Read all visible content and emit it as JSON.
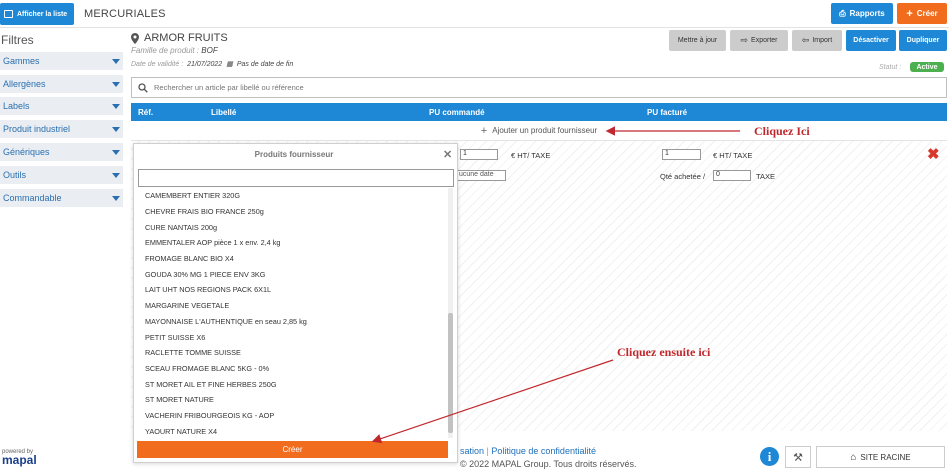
{
  "topbar": {
    "list_button": "Afficher la liste",
    "title": "MERCURIALES",
    "reports_button": "Rapports",
    "create_button": "Créer"
  },
  "sidebar": {
    "title": "Filtres",
    "items": [
      {
        "label": "Gammes"
      },
      {
        "label": "Allergènes"
      },
      {
        "label": "Labels"
      },
      {
        "label": "Produit industriel"
      },
      {
        "label": "Génériques"
      },
      {
        "label": "Outils"
      },
      {
        "label": "Commandable"
      }
    ]
  },
  "header": {
    "product_name": "ARMOR FRUITS",
    "family_label": "Famille de produit :",
    "family_value": "BOF",
    "validity_label": "Date de validité :",
    "validity_date": "21/07/2022",
    "validity_end": "Pas de date de fin",
    "status_label": "Statut :",
    "status_value": "Active"
  },
  "toolbar": {
    "update": "Mettre à jour",
    "export": "Exporter",
    "import": "Import",
    "deactivate": "Désactiver",
    "duplicate": "Dupliquer"
  },
  "search": {
    "placeholder": "Rechercher un article par libellé ou référence"
  },
  "table": {
    "headers": [
      "Réf.",
      "Libellé",
      "PU commandé",
      "PU facturé"
    ],
    "add_label": "Ajouter un produit fournisseur",
    "row": {
      "pu_cmd_value": "1",
      "pu_cmd_unit": "€ HT/ TAXE",
      "pu_fact_value": "1",
      "pu_fact_unit": "€ HT/ TAXE",
      "date_placeholder": "ucune date",
      "qty_label": "Qté achetée /",
      "qty_value": "0",
      "qty_unit": "TAXE"
    }
  },
  "dropdown": {
    "title": "Produits fournisseur",
    "items": [
      "CAMEMBERT ENTIER 320G",
      "CHEVRE FRAIS BIO FRANCE 250g",
      "CURE NANTAIS 200g",
      "EMMENTALER AOP pièce 1 x env. 2,4 kg",
      "FROMAGE BLANC BIO X4",
      "GOUDA 30% MG 1 PIECE ENV 3KG",
      "LAIT UHT NOS REGIONS PACK 6X1L",
      "MARGARINE VEGETALE",
      "MAYONNAISE L'AUTHENTIQUE en seau 2,85 kg",
      "PETIT SUISSE X6",
      "RACLETTE TOMME SUISSE",
      "SCEAU FROMAGE BLANC 5KG - 0%",
      "ST MORET AIL ET FINE HERBES 250G",
      "ST MORET NATURE",
      "VACHERIN FRIBOURGEOIS KG - AOP",
      "YAOURT NATURE X4"
    ],
    "create_button": "Créer"
  },
  "annotations": {
    "first": "Cliquez Ici",
    "second": "Cliquez ensuite ici",
    "color": "#c0282d"
  },
  "footer": {
    "links_fragment": "sation",
    "privacy": "Politique de confidentialité",
    "copyright_fragment": "© 2022 MAPAL Group. Tous droits réservés.",
    "powered_by": "powered by",
    "brand": "mapal",
    "site_button": "SITE RACINE"
  },
  "colors": {
    "primary": "#1e88d6",
    "accent": "#f26c1e",
    "success": "#4caf50",
    "danger": "#c0282d"
  },
  "icons": {
    "list": "list-icon",
    "reports": "printer-icon",
    "create": "plus-icon",
    "location": "map-pin-icon",
    "calendar": "calendar-icon",
    "search": "search-icon",
    "export": "export-icon",
    "import": "import-icon",
    "delete": "close-icon",
    "info": "info-icon",
    "home": "home-icon"
  }
}
